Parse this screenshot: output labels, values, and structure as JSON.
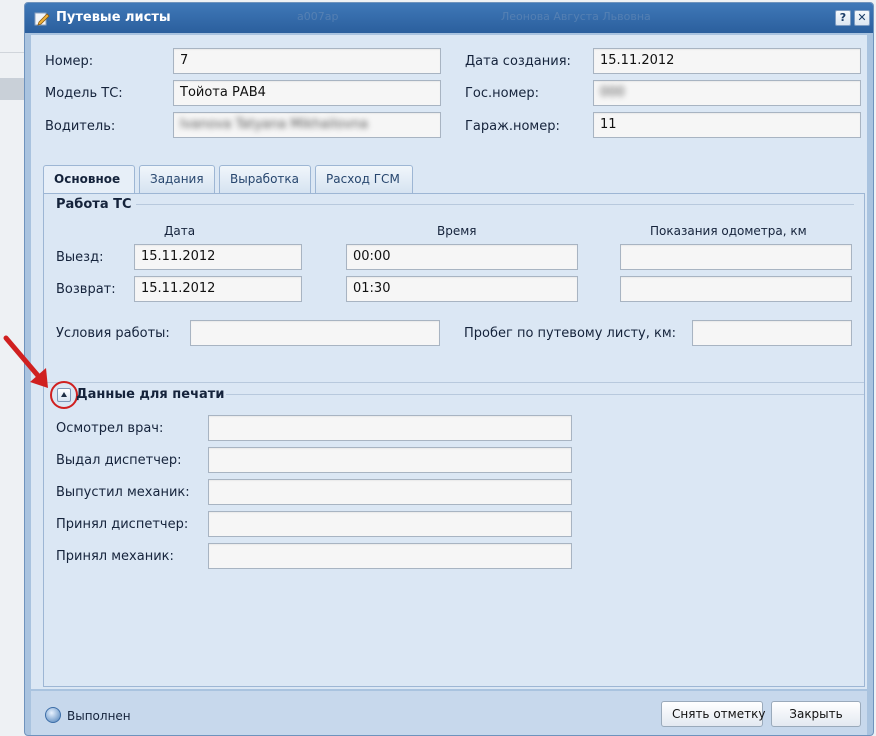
{
  "window": {
    "title": "Путевые листы",
    "background_text": [
      "a007ap",
      "Леонова Августа Львовна"
    ],
    "help_label": "?",
    "close_label": "✕"
  },
  "header_fields": {
    "number_label": "Номер:",
    "number_value": "7",
    "model_label": "Модель ТС:",
    "model_value": "Тойота РАВ4",
    "driver_label": "Водитель:",
    "driver_value": "Ivanova Tatyana Mikhailovna",
    "created_label": "Дата создания:",
    "created_value": "15.11.2012",
    "plate_label": "Гос.номер:",
    "plate_value": "000",
    "garage_label": "Гараж.номер:",
    "garage_value": "11"
  },
  "tabs": [
    {
      "label": "Основное",
      "active": true
    },
    {
      "label": "Задания",
      "active": false
    },
    {
      "label": "Выработка",
      "active": false
    },
    {
      "label": "Расход ГСМ",
      "active": false
    }
  ],
  "work": {
    "title": "Работа ТС",
    "col_date": "Дата",
    "col_time": "Время",
    "col_odometer": "Показания одометра, км",
    "departure_label": "Выезд:",
    "departure_date": "15.11.2012",
    "departure_time": "00:00",
    "departure_odometer": "",
    "return_label": "Возврат:",
    "return_date": "15.11.2012",
    "return_time": "01:30",
    "return_odometer": "",
    "conditions_label": "Условия работы:",
    "conditions_value": "",
    "mileage_label": "Пробег по путевому листу, км:",
    "mileage_value": ""
  },
  "print": {
    "title": "Данные для печати",
    "rows": [
      {
        "label": "Осмотрел врач:",
        "value": ""
      },
      {
        "label": "Выдал диспетчер:",
        "value": ""
      },
      {
        "label": "Выпустил механик:",
        "value": ""
      },
      {
        "label": "Принял диспетчер:",
        "value": ""
      },
      {
        "label": "Принял механик:",
        "value": ""
      }
    ]
  },
  "footer": {
    "status": "Выполнен",
    "unmark_button": "Снять отметку",
    "close_button": "Закрыть"
  },
  "colors": {
    "titlebar": "#2b5f9d",
    "body": "#dbe7f4",
    "annotation": "#d02020"
  }
}
